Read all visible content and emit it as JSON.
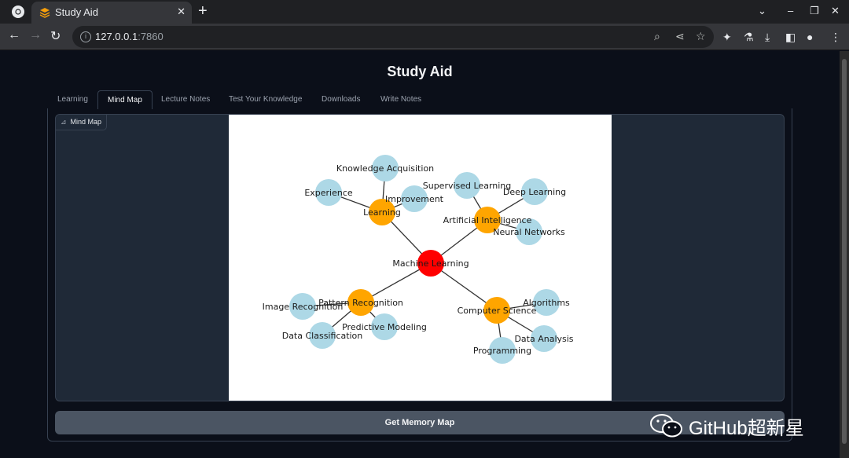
{
  "browser": {
    "tab_title": "Study Aid",
    "url_host": "127.0.0.1",
    "url_port": ":7860"
  },
  "app": {
    "title": "Study Aid",
    "tabs": [
      {
        "label": "Learning"
      },
      {
        "label": "Mind Map"
      },
      {
        "label": "Lecture Notes"
      },
      {
        "label": "Test Your Knowledge"
      },
      {
        "label": "Downloads"
      },
      {
        "label": "Write Notes"
      }
    ],
    "active_tab": "Mind Map",
    "image_label": "Mind Map",
    "button_label": "Get Memory Map"
  },
  "mind_map": {
    "root": {
      "label": "Machine Learning",
      "color": "#ff0000"
    },
    "branches": [
      {
        "label": "Learning",
        "color": "#ffa500",
        "children": [
          "Knowledge Acquisition",
          "Experience",
          "Improvement"
        ]
      },
      {
        "label": "Artificial Intelligence",
        "color": "#ffa500",
        "children": [
          "Supervised Learning",
          "Deep Learning",
          "Neural Networks"
        ]
      },
      {
        "label": "Pattern Recognition",
        "color": "#ffa500",
        "children": [
          "Image Recognition",
          "Data Classification",
          "Predictive Modeling"
        ]
      },
      {
        "label": "Computer Science",
        "color": "#ffa500",
        "children": [
          "Algorithms",
          "Data Analysis",
          "Programming"
        ]
      }
    ],
    "leaf_color": "#add8e6"
  },
  "watermark": {
    "text": "GitHub超新星"
  },
  "colors": {
    "background": "#0b0f19",
    "panel": "#1f2937",
    "button": "#4b5563",
    "root_node": "#ff0000",
    "branch_node": "#ffa500",
    "leaf_node": "#add8e6"
  }
}
